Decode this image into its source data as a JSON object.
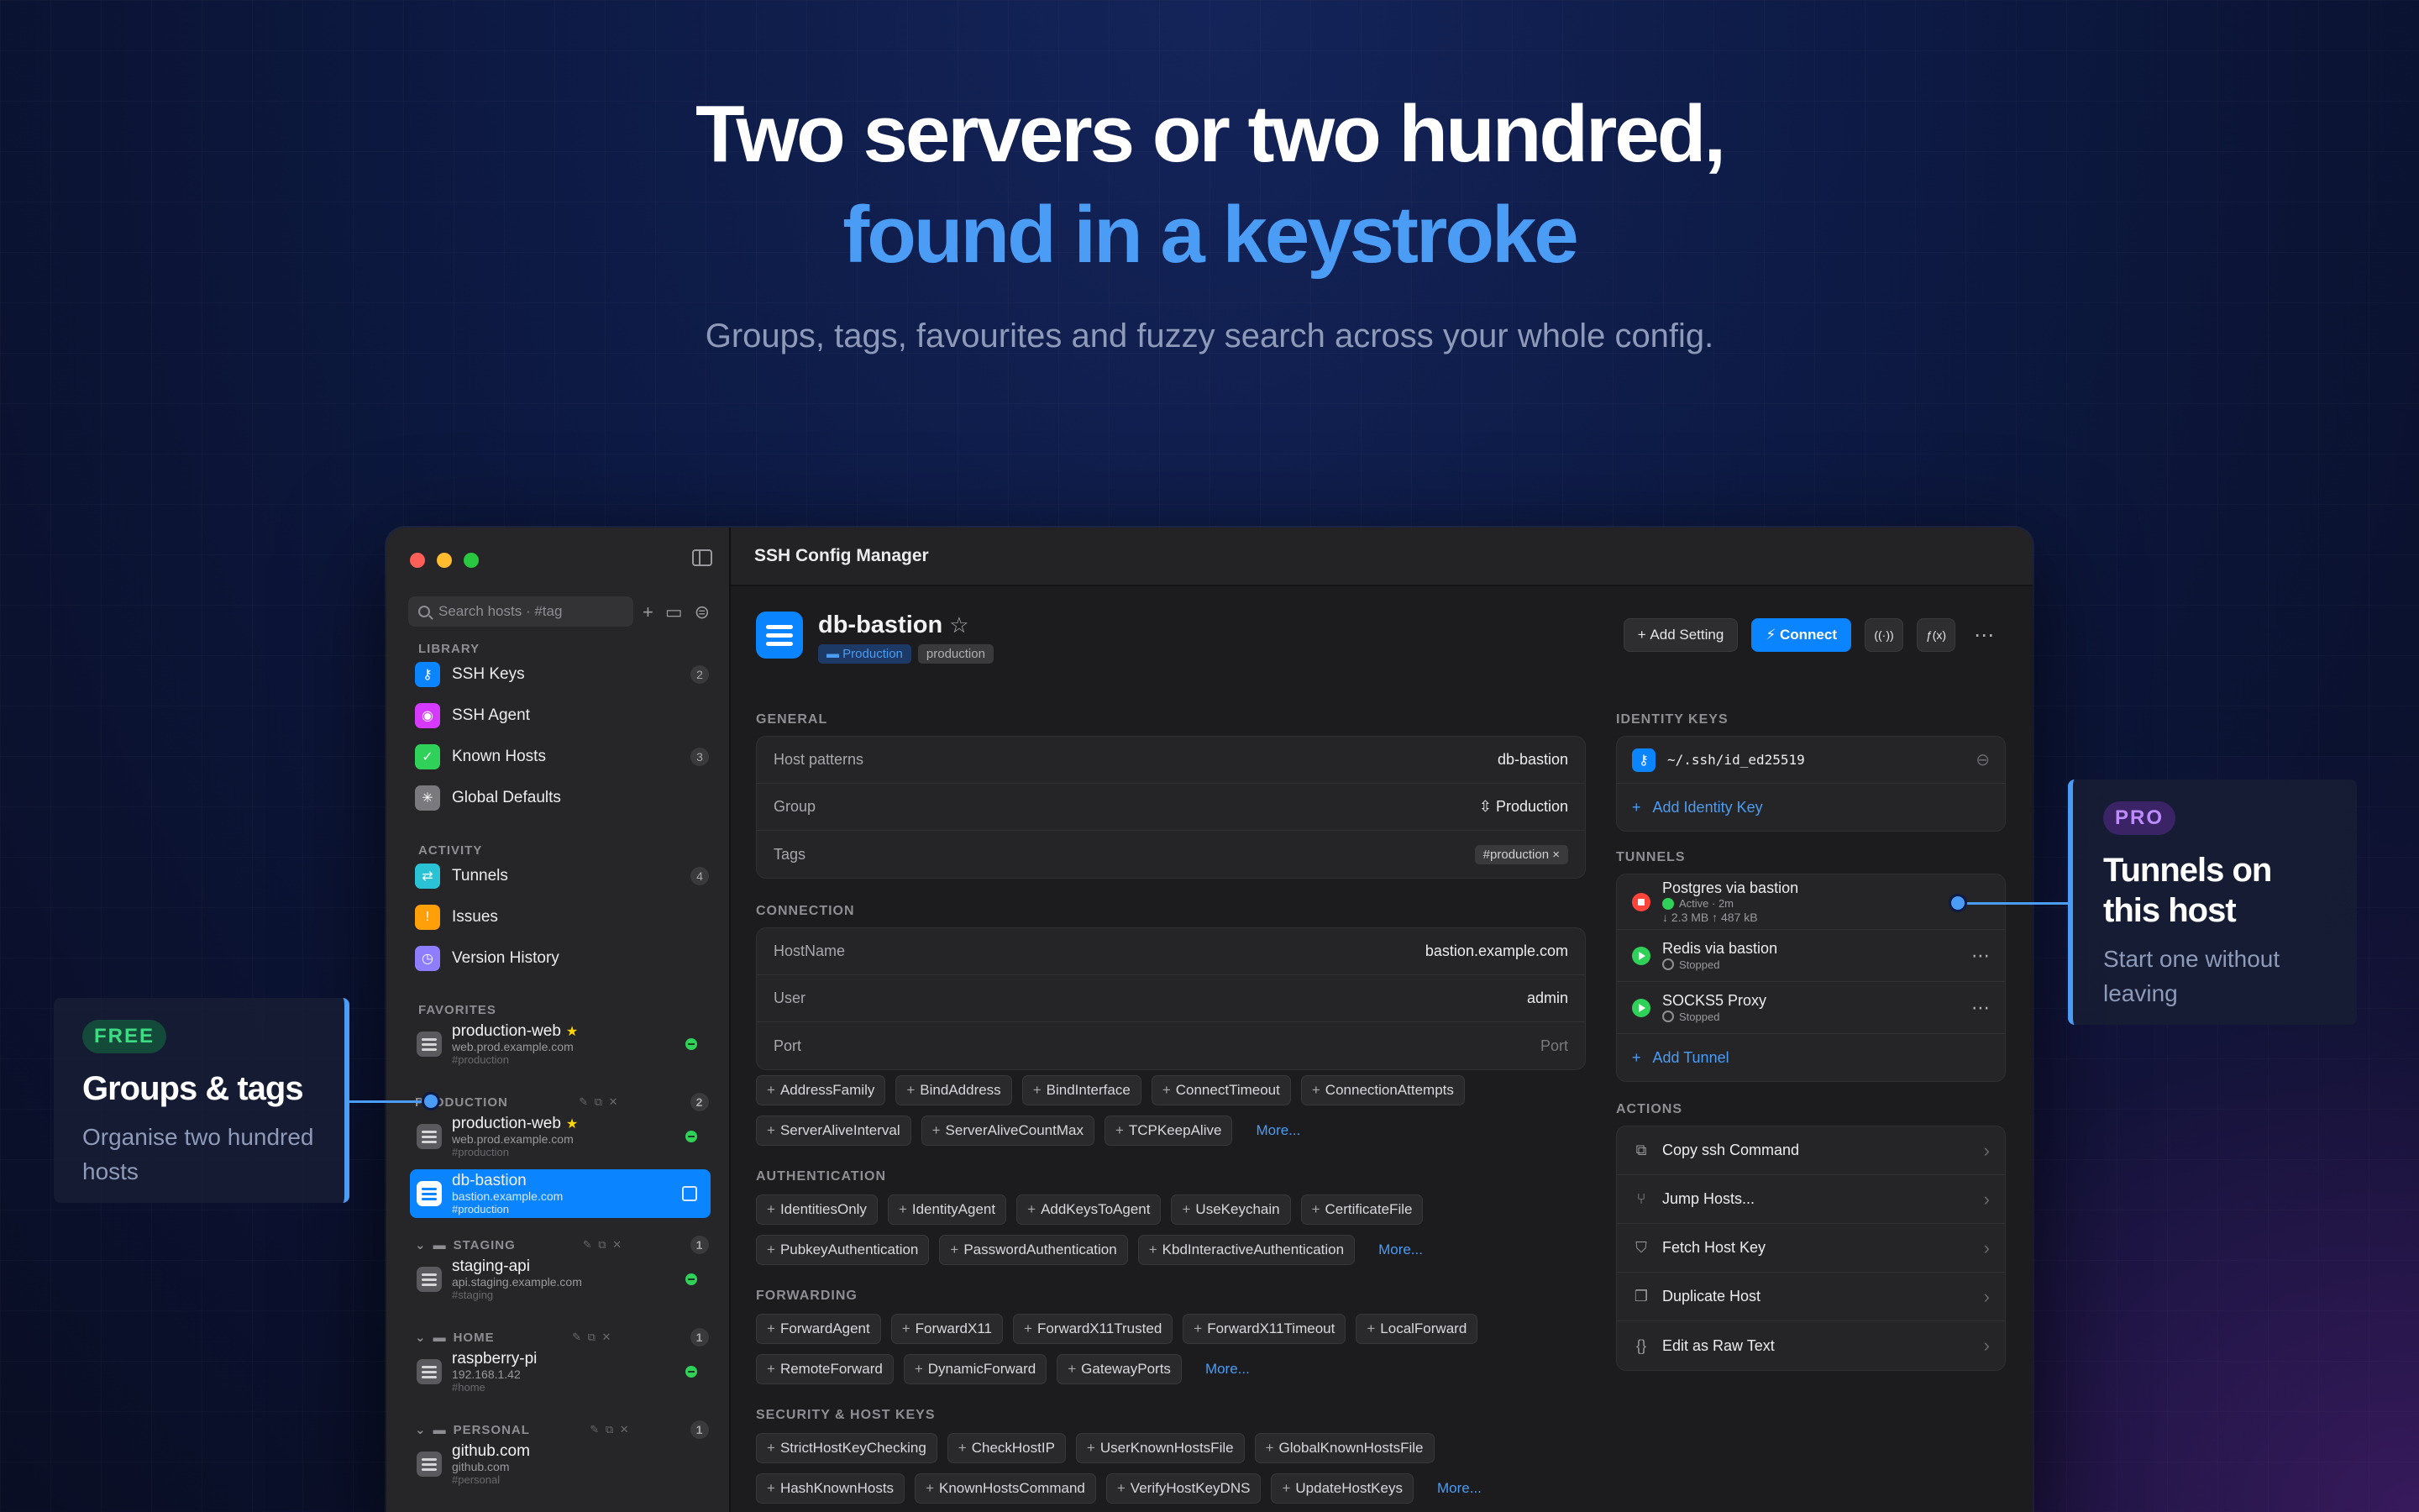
{
  "hero": {
    "line1": "Two servers or two hundred,",
    "line2": "found in a keystroke",
    "subtitle": "Groups, tags, favourites and fuzzy search across your whole config."
  },
  "window": {
    "title": "SSH Config Manager"
  },
  "sidebar": {
    "search_placeholder": "Search hosts · #tag",
    "library_label": "LIBRARY",
    "library": [
      {
        "label": "SSH Keys",
        "count": "2",
        "icon": "key-icon",
        "color": "#0a84ff"
      },
      {
        "label": "SSH Agent",
        "count": "",
        "icon": "agent-icon",
        "color": "#d63aff"
      },
      {
        "label": "Known Hosts",
        "count": "3",
        "icon": "shield-check-icon",
        "color": "#30d158"
      },
      {
        "label": "Global Defaults",
        "count": "",
        "icon": "asterisk-icon",
        "color": "#7a7a7e"
      }
    ],
    "activity_label": "ACTIVITY",
    "activity": [
      {
        "label": "Tunnels",
        "count": "4",
        "icon": "tunnel-icon",
        "color": "#2ac3d6"
      },
      {
        "label": "Issues",
        "count": "",
        "icon": "warning-icon",
        "color": "#ff9f0a"
      },
      {
        "label": "Version History",
        "count": "",
        "icon": "history-icon",
        "color": "#8e7dff"
      }
    ],
    "favorites_label": "FAVORITES",
    "favorites": [
      {
        "name": "production-web",
        "sub": "web.prod.example.com",
        "tag": "#production"
      }
    ],
    "groups": [
      {
        "label": "PRODUCTION",
        "count": "2",
        "hosts": [
          {
            "name": "production-web",
            "sub": "web.prod.example.com",
            "tag": "#production"
          },
          {
            "name": "db-bastion",
            "sub": "bastion.example.com",
            "tag": "#production"
          }
        ]
      },
      {
        "label": "STAGING",
        "count": "1",
        "hosts": [
          {
            "name": "staging-api",
            "sub": "api.staging.example.com",
            "tag": "#staging"
          }
        ]
      },
      {
        "label": "HOME",
        "count": "1",
        "hosts": [
          {
            "name": "raspberry-pi",
            "sub": "192.168.1.42",
            "tag": "#home"
          }
        ]
      },
      {
        "label": "PERSONAL",
        "count": "1",
        "hosts": [
          {
            "name": "github.com",
            "sub": "github.com",
            "tag": "#personal"
          }
        ]
      }
    ]
  },
  "host": {
    "name": "db-bastion",
    "group_chip": "Production",
    "tag_chip": "production",
    "actions": {
      "add_setting": "Add Setting",
      "connect": "Connect"
    }
  },
  "general": {
    "label": "GENERAL",
    "host_patterns_k": "Host patterns",
    "host_patterns_v": "db-bastion",
    "group_k": "Group",
    "group_v": "Production",
    "tags_k": "Tags",
    "tags_v": "#production ×"
  },
  "connection": {
    "label": "CONNECTION",
    "hostname_k": "HostName",
    "hostname_v": "bastion.example.com",
    "user_k": "User",
    "user_v": "admin",
    "port_k": "Port",
    "port_v": "Port",
    "options": [
      "AddressFamily",
      "BindAddress",
      "BindInterface",
      "ConnectTimeout",
      "ConnectionAttempts",
      "ServerAliveInterval",
      "ServerAliveCountMax",
      "TCPKeepAlive"
    ]
  },
  "authentication": {
    "label": "AUTHENTICATION",
    "options": [
      "IdentitiesOnly",
      "IdentityAgent",
      "AddKeysToAgent",
      "UseKeychain",
      "CertificateFile",
      "PubkeyAuthentication",
      "PasswordAuthentication",
      "KbdInteractiveAuthentication"
    ]
  },
  "forwarding": {
    "label": "FORWARDING",
    "options": [
      "ForwardAgent",
      "ForwardX11",
      "ForwardX11Trusted",
      "ForwardX11Timeout",
      "LocalForward",
      "RemoteForward",
      "DynamicForward",
      "GatewayPorts"
    ]
  },
  "security": {
    "label": "SECURITY & HOST KEYS",
    "options": [
      "StrictHostKeyChecking",
      "CheckHostIP",
      "UserKnownHostsFile",
      "GlobalKnownHostsFile",
      "HashKnownHosts",
      "KnownHostsCommand",
      "VerifyHostKeyDNS",
      "UpdateHostKeys"
    ]
  },
  "more_label": "More...",
  "identity": {
    "label": "IDENTITY KEYS",
    "key": "~/.ssh/id_ed25519",
    "add": "Add Identity Key"
  },
  "tunnels": {
    "label": "TUNNELS",
    "items": [
      {
        "name": "Postgres via bastion",
        "status": "Active · 2m",
        "traffic": "↓ 2.3 MB  ↑ 487 kB",
        "running": true
      },
      {
        "name": "Redis via bastion",
        "status": "Stopped",
        "traffic": "",
        "running": false
      },
      {
        "name": "SOCKS5 Proxy",
        "status": "Stopped",
        "traffic": "",
        "running": false
      }
    ],
    "add": "Add Tunnel"
  },
  "actions": {
    "label": "ACTIONS",
    "items": [
      {
        "label": "Copy ssh Command",
        "icon": "copy-icon"
      },
      {
        "label": "Jump Hosts...",
        "icon": "branch-icon"
      },
      {
        "label": "Fetch Host Key",
        "icon": "shield-icon"
      },
      {
        "label": "Duplicate Host",
        "icon": "duplicate-icon"
      },
      {
        "label": "Edit as Raw Text",
        "icon": "braces-icon"
      }
    ]
  },
  "callouts": {
    "left": {
      "badge": "FREE",
      "title": "Groups & tags",
      "desc": "Organise two hundred hosts"
    },
    "right": {
      "badge": "PRO",
      "title": "Tunnels on this host",
      "desc": "Start one without leaving"
    }
  }
}
